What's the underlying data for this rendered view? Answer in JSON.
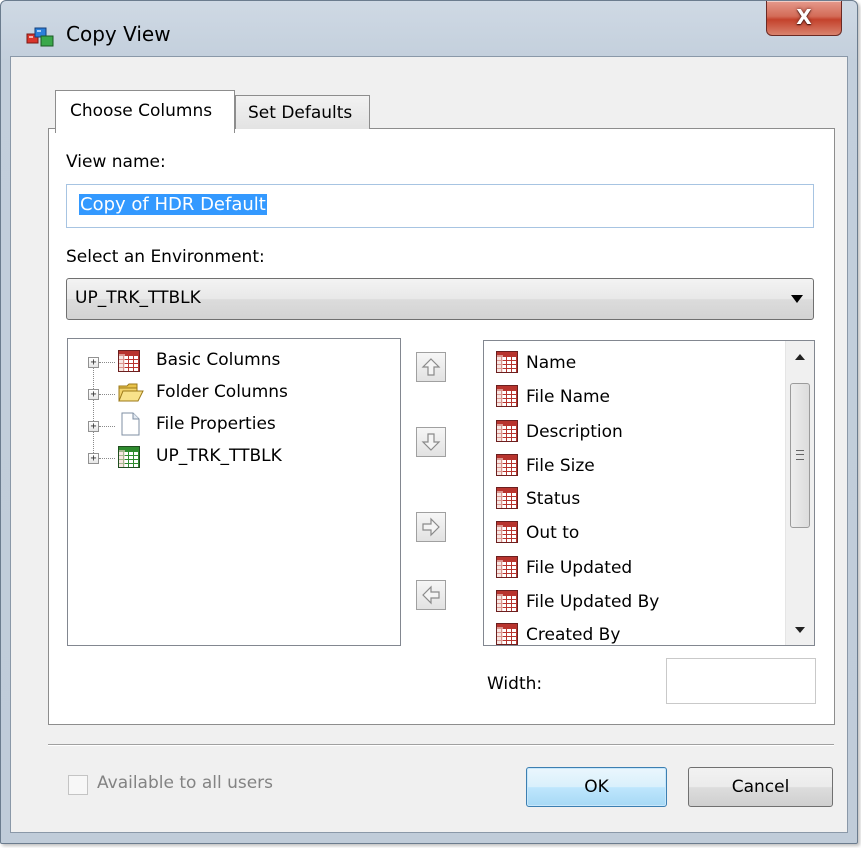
{
  "window": {
    "title": "Copy View",
    "close_glyph": "X"
  },
  "tabs": [
    {
      "label": "Choose Columns",
      "selected": true
    },
    {
      "label": "Set Defaults",
      "selected": false
    }
  ],
  "form": {
    "view_name_label": "View name:",
    "view_name_value": "Copy of HDR Default",
    "environment_label": "Select an Environment:",
    "environment_value": "UP_TRK_TTBLK",
    "width_label": "Width:",
    "width_value": ""
  },
  "tree": {
    "items": [
      {
        "label": "Basic Columns",
        "icon": "grid-red-icon"
      },
      {
        "label": "Folder Columns",
        "icon": "folder-icon"
      },
      {
        "label": "File Properties",
        "icon": "document-icon"
      },
      {
        "label": "UP_TRK_TTBLK",
        "icon": "grid-green-icon"
      }
    ]
  },
  "columns_list": {
    "items": [
      "Name",
      "File Name",
      "Description",
      "File Size",
      "Status",
      "Out to",
      "File Updated",
      "File Updated By",
      "Created By"
    ]
  },
  "move_buttons": [
    "move-up-icon",
    "move-down-icon",
    "add-right-icon",
    "remove-left-icon"
  ],
  "footer": {
    "available_label": "Available to all users",
    "available_checked": false,
    "ok_label": "OK",
    "cancel_label": "Cancel"
  },
  "colors": {
    "title_bar": "#c3cfdc",
    "close_button": "#c4422c",
    "selection": "#3399ff",
    "grid_icon_red": "#b8342e",
    "grid_icon_green": "#2e8b2e"
  }
}
